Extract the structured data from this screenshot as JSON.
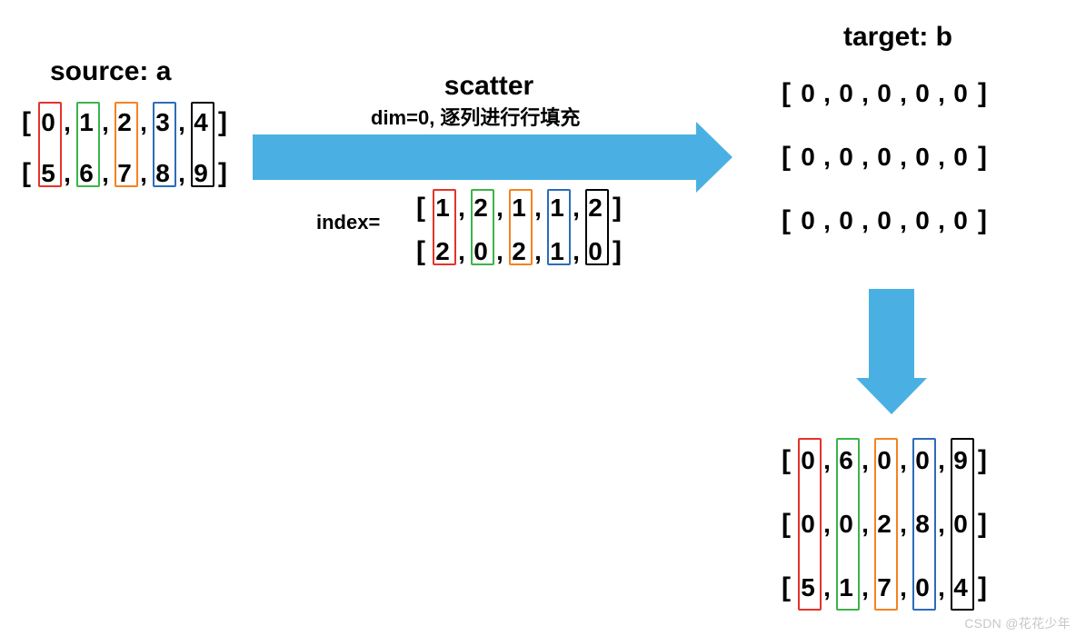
{
  "source": {
    "title": "source: a",
    "rows": [
      [
        "0",
        "1",
        "2",
        "3",
        "4"
      ],
      [
        "5",
        "6",
        "7",
        "8",
        "9"
      ]
    ]
  },
  "operation": {
    "title": "scatter",
    "subtitle": "dim=0, 逐列进行行填充"
  },
  "index": {
    "label": "index=",
    "rows": [
      [
        "1",
        "2",
        "1",
        "1",
        "2"
      ],
      [
        "2",
        "0",
        "2",
        "1",
        "0"
      ]
    ]
  },
  "target": {
    "title": "target: b",
    "rows": [
      [
        "0",
        "0",
        "0",
        "0",
        "0"
      ],
      [
        "0",
        "0",
        "0",
        "0",
        "0"
      ],
      [
        "0",
        "0",
        "0",
        "0",
        "0"
      ]
    ]
  },
  "result": {
    "rows": [
      [
        "0",
        "6",
        "0",
        "0",
        "9"
      ],
      [
        "0",
        "0",
        "2",
        "8",
        "0"
      ],
      [
        "5",
        "1",
        "7",
        "0",
        "4"
      ]
    ]
  },
  "colors": {
    "red": "#e4332a",
    "green": "#3bb44a",
    "orange": "#f58220",
    "blue": "#2b6cb8",
    "black": "#000000",
    "arrow": "#4ab0e3"
  },
  "watermark": "CSDN @花花少年"
}
